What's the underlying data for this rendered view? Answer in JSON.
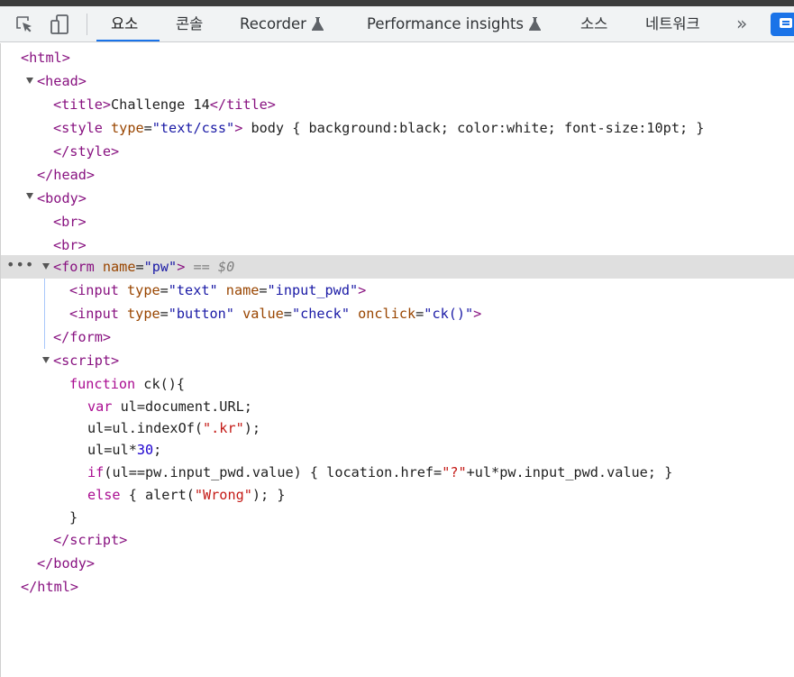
{
  "toolbar": {
    "tabs": [
      {
        "label": "요소",
        "active": true
      },
      {
        "label": "콘솔"
      },
      {
        "label": "Recorder",
        "experimental": true
      },
      {
        "label": "Performance insights",
        "experimental": true
      },
      {
        "label": "소스"
      },
      {
        "label": "네트워크"
      }
    ],
    "more": "»",
    "accent": "#1a73e8"
  },
  "dom": {
    "selected_marker": "== $0",
    "html_open": "html",
    "head_open": "head",
    "title_tag": "title",
    "title_text": "Challenge 14",
    "style_tag": "style",
    "style_type_attr": "type",
    "style_type_val": "\"text/css\"",
    "style_text": " body { background:black; color:white; font-size:10pt; } ",
    "br": "br",
    "body_tag": "body",
    "form_tag": "form",
    "form_name_attr": "name",
    "form_name_val": "\"pw\"",
    "input_tag": "input",
    "input1_type_attr": "type",
    "input1_type_val": "\"text\"",
    "input1_name_attr": "name",
    "input1_name_val": "\"input_pwd\"",
    "input2_type_attr": "type",
    "input2_type_val": "\"button\"",
    "input2_value_attr": "value",
    "input2_value_val": "\"check\"",
    "input2_onclick_attr": "onclick",
    "input2_onclick_val": "\"ck()\"",
    "script_tag": "script",
    "script": {
      "l1_kw": "function",
      "l1_rest": " ck(){",
      "l2_kw": "var",
      "l2_rest": " ul=document.URL;",
      "l3_a": "ul=ul.indexOf(",
      "l3_str": "\".kr\"",
      "l3_b": ");",
      "l4_a": "ul=ul*",
      "l4_num": "30",
      "l4_b": ";",
      "l5_kw": "if",
      "l5_a": "(ul==pw.input_pwd.value) { location.href=",
      "l5_str": "\"?\"",
      "l5_b": "+ul*pw.input_pwd.value; }",
      "l6_kw": "else",
      "l6_a": " { alert(",
      "l6_str": "\"Wrong\"",
      "l6_b": "); }",
      "l7": "}"
    }
  }
}
